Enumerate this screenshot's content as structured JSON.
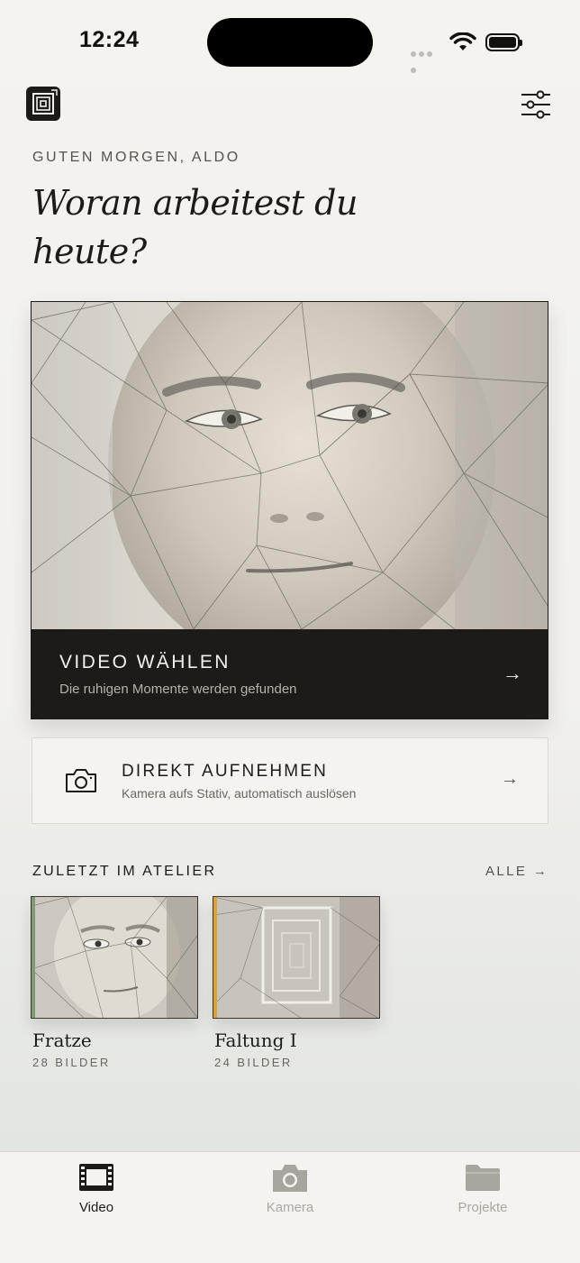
{
  "status_bar": {
    "time": "12:24"
  },
  "header": {
    "logo_icon": "app-logo-icon",
    "filter_icon": "sliders-icon"
  },
  "greeting": "GUTEN MORGEN, ALDO",
  "headline": "Woran arbeitest du heute?",
  "primary_card": {
    "title": "VIDEO WÄHLEN",
    "subtitle": "Die ruhigen Momente werden gefunden",
    "arrow": "→",
    "accent_color": "#d9a23a"
  },
  "secondary_card": {
    "title": "DIREKT AUFNEHMEN",
    "subtitle": "Kamera aufs Stativ, automatisch auslösen",
    "arrow": "→",
    "icon": "camera-icon"
  },
  "recent": {
    "title": "ZULETZT IM ATELIER",
    "see_all": "ALLE →",
    "items": [
      {
        "name": "Fratze",
        "count": "28 BILDER",
        "accent_color": "#7f9a78"
      },
      {
        "name": "Faltung I",
        "count": "24 BILDER",
        "accent_color": "#d9a23a"
      }
    ]
  },
  "tabs": [
    {
      "label": "Video",
      "icon": "film-icon",
      "active": true
    },
    {
      "label": "Kamera",
      "icon": "camera-icon",
      "active": false
    },
    {
      "label": "Projekte",
      "icon": "folder-icon",
      "active": false
    }
  ]
}
